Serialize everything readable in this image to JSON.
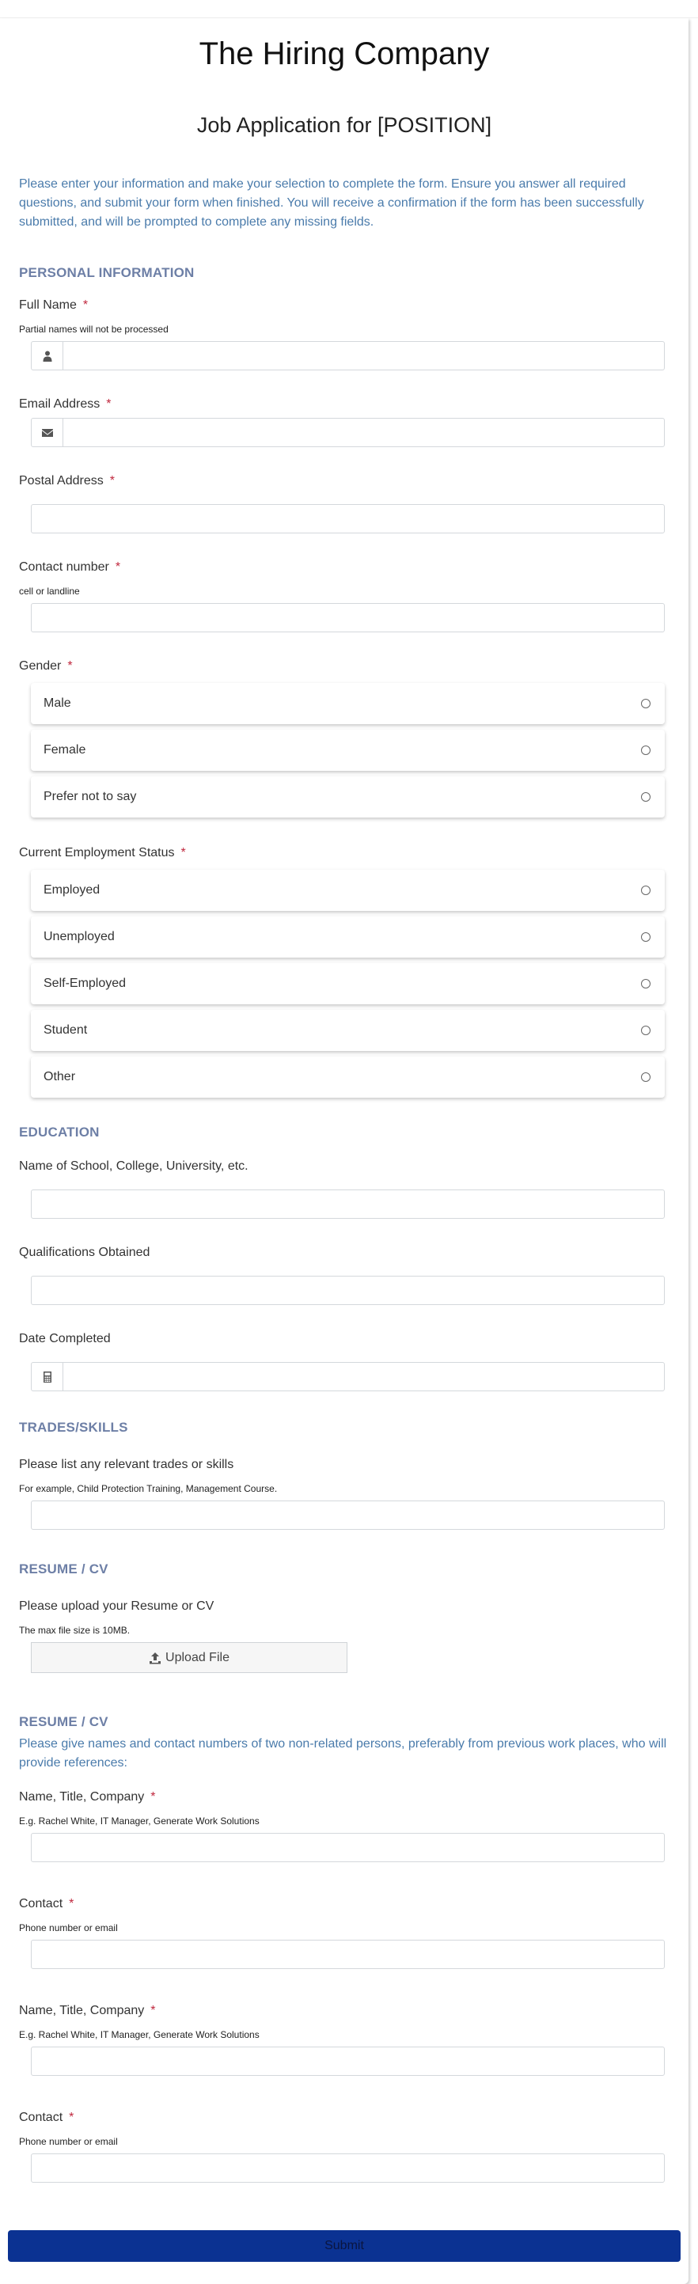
{
  "header": {
    "company": "The Hiring Company",
    "job_title": "Job Application for [POSITION]",
    "intro": "Please enter your information and make your selection to complete the form. Ensure you answer all required questions, and submit your form when finished. You will receive a confirmation if the form has been successfully submitted, and will be prompted to complete any missing fields."
  },
  "required_marker": "*",
  "colors": {
    "section_title": "#6d7fa6",
    "intro_text": "#4a7bab",
    "required": "#c0283e",
    "submit_bg": "#0b3292"
  },
  "personal": {
    "title": "PERSONAL INFORMATION",
    "full_name": {
      "label": "Full Name",
      "hint": "Partial names will not be processed",
      "value": "",
      "icon": "user-icon"
    },
    "email": {
      "label": "Email Address",
      "value": "",
      "icon": "envelope-icon"
    },
    "postal": {
      "label": "Postal Address",
      "value": ""
    },
    "contact": {
      "label": "Contact number",
      "hint": "cell or landline",
      "value": ""
    },
    "gender": {
      "label": "Gender",
      "options": [
        "Male",
        "Female",
        "Prefer not to say"
      ],
      "selected": null
    },
    "employment": {
      "label": "Current Employment Status",
      "options": [
        "Employed",
        "Unemployed",
        "Self-Employed",
        "Student",
        "Other"
      ],
      "selected": null
    }
  },
  "education": {
    "title": "EDUCATION",
    "school": {
      "label": "Name of School, College, University, etc.",
      "value": ""
    },
    "qualifications": {
      "label": "Qualifications Obtained",
      "value": ""
    },
    "date": {
      "label": "Date Completed",
      "value": "",
      "icon": "calculator-icon"
    }
  },
  "skills": {
    "title": "TRADES/SKILLS",
    "list": {
      "label": "Please list any relevant trades or skills",
      "hint": "For example, Child Protection Training, Management Course.",
      "value": ""
    }
  },
  "resume": {
    "title": "RESUME / CV",
    "upload": {
      "label": "Please upload your Resume or CV",
      "hint": "The max file size is 10MB.",
      "button": "Upload File",
      "icon": "upload-icon"
    }
  },
  "references": {
    "title": "RESUME / CV",
    "description": "Please give names and contact numbers of two non-related persons, preferably from previous work places, who will provide references:",
    "items": [
      {
        "name_label": "Name, Title, Company",
        "name_hint": "E.g. Rachel White, IT Manager, Generate Work Solutions",
        "name_value": "",
        "contact_label": "Contact",
        "contact_hint": "Phone number or email",
        "contact_value": ""
      },
      {
        "name_label": "Name, Title, Company",
        "name_hint": "E.g. Rachel White, IT Manager, Generate Work Solutions",
        "name_value": "",
        "contact_label": "Contact",
        "contact_hint": "Phone number or email",
        "contact_value": ""
      }
    ]
  },
  "submit_label": "Submit"
}
